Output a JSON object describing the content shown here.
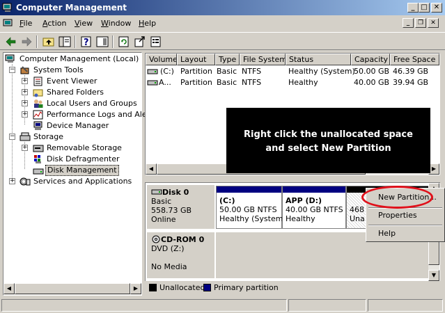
{
  "window": {
    "title": "Computer Management",
    "caption_buttons": {
      "minimize": "_",
      "maximize": "□",
      "close": "✕"
    }
  },
  "menu": [
    {
      "key": "F",
      "rest": "ile"
    },
    {
      "key": "A",
      "rest": "ction"
    },
    {
      "key": "V",
      "rest": "iew"
    },
    {
      "key": "W",
      "rest": "indow"
    },
    {
      "key": "H",
      "rest": "elp"
    }
  ],
  "mdi_buttons": {
    "minimize": "_",
    "restore": "❐",
    "close": "✕"
  },
  "toolbar": {
    "icons": [
      "back-icon",
      "forward-icon",
      "up-folder-icon",
      "show-hide-tree-icon",
      "help-icon",
      "show-hide-console-icon",
      "refresh-icon",
      "export-icon",
      "properties-icon"
    ]
  },
  "tree": {
    "root": "Computer Management (Local)",
    "system_tools": "System Tools",
    "event_viewer": "Event Viewer",
    "shared_folders": "Shared Folders",
    "local_users": "Local Users and Groups",
    "perf_logs": "Performance Logs and Alerts",
    "device_manager": "Device Manager",
    "storage": "Storage",
    "removable_storage": "Removable Storage",
    "disk_defrag": "Disk Defragmenter",
    "disk_management": "Disk Management",
    "services_apps": "Services and Applications",
    "expander_minus": "−",
    "expander_plus": "+"
  },
  "volumes": {
    "columns": [
      "Volume",
      "Layout",
      "Type",
      "File System",
      "Status",
      "Capacity",
      "Free Space"
    ],
    "rows": [
      {
        "volume": "(C:)",
        "layout": "Partition",
        "type": "Basic",
        "fs": "NTFS",
        "status": "Healthy (System)",
        "capacity": "50.00 GB",
        "free": "46.39 GB"
      },
      {
        "volume": "A...",
        "layout": "Partition",
        "type": "Basic",
        "fs": "NTFS",
        "status": "Healthy",
        "capacity": "40.00 GB",
        "free": "39.94 GB"
      }
    ]
  },
  "overlay": {
    "line1": "Right click the unallocated space",
    "line2": "and select New Partition"
  },
  "disk0": {
    "name": "Disk 0",
    "type": "Basic",
    "size": "558.73 GB",
    "status": "Online",
    "partitions": [
      {
        "label": "(C:)",
        "size": "50.00 GB NTFS",
        "status": "Healthy (System"
      },
      {
        "label": "APP  (D:)",
        "size": "40.00 GB NTFS",
        "status": "Healthy"
      },
      {
        "size": "468",
        "status": "Una"
      }
    ]
  },
  "cdrom0": {
    "name": "CD-ROM 0",
    "type": "DVD (Z:)",
    "status": "No Media"
  },
  "legend": {
    "unallocated": "Unallocated",
    "primary": "Primary partition",
    "unallocated_color": "#000000",
    "primary_color": "#000080"
  },
  "context_menu": {
    "new_partition": "New Partition...",
    "properties": "Properties",
    "help": "Help"
  },
  "scroll": {
    "up": "▲",
    "down": "▼",
    "left": "◀",
    "right": "▶"
  }
}
